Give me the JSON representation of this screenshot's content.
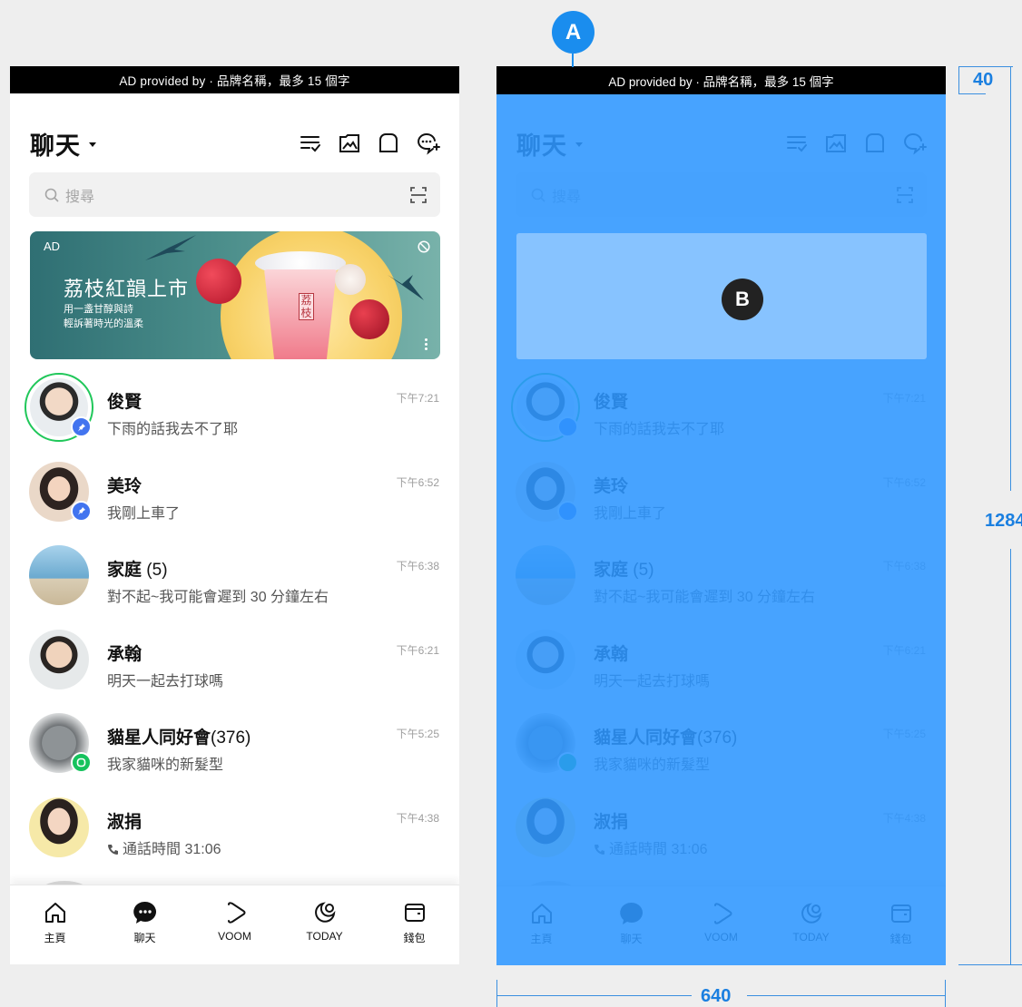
{
  "ad_bar": "AD provided by · 品牌名稱，最多 15 個字",
  "header": {
    "title": "聊天"
  },
  "search": {
    "placeholder": "搜尋"
  },
  "banner": {
    "ad_label": "AD",
    "title": "荔枝紅韻上市",
    "subtitle_line1": "用一盞甘醇與詩",
    "subtitle_line2": "輕訴著時光的溫柔",
    "cup_label": "荔枝"
  },
  "chats": [
    {
      "name": "俊賢",
      "count": "",
      "message": "下雨的話我去不了耶",
      "time": "下午7:21",
      "badge": "pin",
      "ring": true
    },
    {
      "name": "美玲",
      "count": "",
      "message": "我剛上車了",
      "time": "下午6:52",
      "badge": "pin",
      "ring": false
    },
    {
      "name": "家庭",
      "count": "(5)",
      "message": "對不起~我可能會遲到 30 分鐘左右",
      "time": "下午6:38",
      "badge": "",
      "ring": false
    },
    {
      "name": "承翰",
      "count": "",
      "message": "明天一起去打球嗎",
      "time": "下午6:21",
      "badge": "",
      "ring": false
    },
    {
      "name": "貓星人同好會",
      "count": "(376)",
      "message": "我家貓咪的新髮型",
      "time": "下午5:25",
      "badge": "openchat",
      "ring": false
    },
    {
      "name": "淑捐",
      "count": "",
      "message": "通話時間 31:06",
      "time": "下午4:38",
      "badge": "",
      "ring": false
    }
  ],
  "tabs": [
    {
      "label": "主頁",
      "icon": "home-icon"
    },
    {
      "label": "聊天",
      "icon": "chat-icon"
    },
    {
      "label": "VOOM",
      "icon": "voom-icon"
    },
    {
      "label": "TODAY",
      "icon": "today-icon"
    },
    {
      "label": "錢包",
      "icon": "wallet-icon"
    }
  ],
  "annotations": {
    "marker_a": "A",
    "marker_b": "B",
    "dim_top": "40",
    "dim_height": "1284",
    "dim_width": "640"
  },
  "colors": {
    "accent": "#1a8dee",
    "overlay": "#3ea0ff",
    "ring": "#20c75a",
    "pin_badge": "#4274ef"
  }
}
